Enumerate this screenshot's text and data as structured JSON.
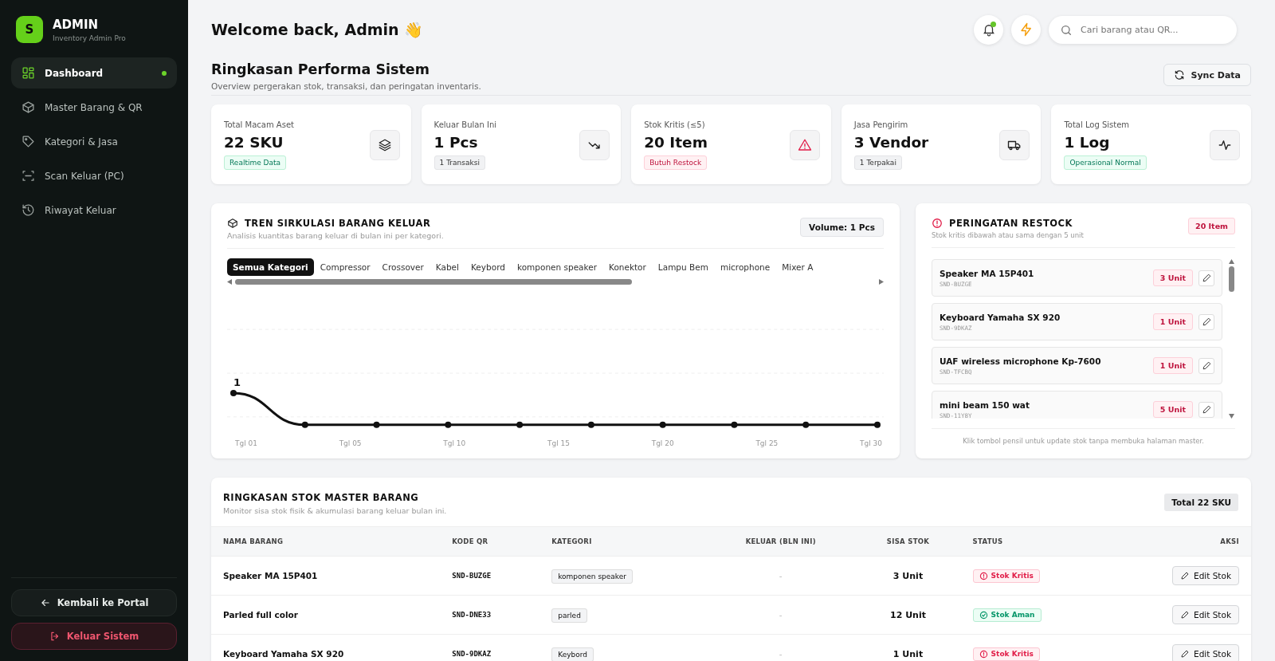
{
  "sidebar": {
    "logo_letter": "S",
    "brand": "ADMIN",
    "subtitle": "Inventory Admin Pro",
    "items": [
      {
        "label": "Dashboard",
        "selected": true
      },
      {
        "label": "Master Barang & QR",
        "selected": false
      },
      {
        "label": "Kategori & Jasa",
        "selected": false
      },
      {
        "label": "Scan Keluar (PC)",
        "selected": false
      },
      {
        "label": "Riwayat Keluar",
        "selected": false
      }
    ],
    "back_button": "Kembali ke Portal",
    "logout_button": "Keluar Sistem"
  },
  "header": {
    "greeting": "Welcome back, Admin 👋",
    "notification_unread": true,
    "search": {
      "placeholder": "Cari barang atau QR..."
    }
  },
  "page": {
    "title": "Ringkasan Performa Sistem",
    "subtitle": "Overview pergerakan stok, transaksi, dan peringatan inventaris.",
    "sync_button": "Sync Data"
  },
  "stats": [
    {
      "label": "Total Macam Aset",
      "value": "22 SKU",
      "badge": "Realtime Data",
      "kind": "success"
    },
    {
      "label": "Keluar Bulan Ini",
      "value": "1 Pcs",
      "badge": "1 Transaksi",
      "kind": "neutral"
    },
    {
      "label": "Stok Kritis (≤5)",
      "value": "20 Item",
      "badge": "Butuh Restock",
      "kind": "danger"
    },
    {
      "label": "Jasa Pengirim",
      "value": "3 Vendor",
      "badge": "1 Terpakai",
      "kind": "neutral"
    },
    {
      "label": "Total Log Sistem",
      "value": "1 Log",
      "badge": "Operasional Normal",
      "kind": "success"
    }
  ],
  "trend": {
    "title": "TREN SIRKULASI BARANG KELUAR",
    "subtitle": "Analisis kuantitas barang keluar di bulan ini per kategori.",
    "volume": "Volume: 1 Pcs",
    "tabs": [
      {
        "label": "Semua Kategori",
        "selected": true
      },
      {
        "label": "Compressor",
        "selected": false
      },
      {
        "label": "Crossover",
        "selected": false
      },
      {
        "label": "Kabel",
        "selected": false
      },
      {
        "label": "Keybord",
        "selected": false
      },
      {
        "label": "komponen speaker",
        "selected": false
      },
      {
        "label": "Konektor",
        "selected": false
      },
      {
        "label": "Lampu Bem",
        "selected": false
      },
      {
        "label": "microphone",
        "selected": false
      },
      {
        "label": "Mixer A",
        "selected": false
      }
    ],
    "point_label": "1",
    "axis_labels": [
      "Tgl 01",
      "Tgl 05",
      "Tgl 10",
      "Tgl 15",
      "Tgl 20",
      "Tgl 25",
      "Tgl 30"
    ]
  },
  "restock": {
    "title": "PERINGATAN RESTOCK",
    "subtitle": "Stok kritis dibawah atau sama dengan 5 unit",
    "count": "20 Item",
    "items": [
      {
        "name": "Speaker MA 15P401",
        "code": "SND-BUZGE",
        "stock": "3 Unit"
      },
      {
        "name": "Keyboard Yamaha SX 920",
        "code": "SND-9DKAZ",
        "stock": "1 Unit"
      },
      {
        "name": "UAF wireless microphone Kp-7600",
        "code": "SND-TFCBQ",
        "stock": "1 Unit"
      },
      {
        "name": "mini beam 150 wat",
        "code": "SND-11Y8Y",
        "stock": "5 Unit"
      }
    ],
    "footer": "Klik tombol pensil untuk update stok tanpa membuka halaman master."
  },
  "table": {
    "title": "RINGKASAN STOK MASTER BARANG",
    "subtitle": "Monitor sisa stok fisik & akumulasi barang keluar bulan ini.",
    "total": "Total 22 SKU",
    "columns": [
      "NAMA BARANG",
      "KODE QR",
      "KATEGORI",
      "KELUAR (BLN INI)",
      "SISA STOK",
      "STATUS",
      "AKSI"
    ],
    "rows": [
      {
        "name": "Speaker MA 15P401",
        "code": "SND-BUZGE",
        "category": "komponen speaker",
        "out": "-",
        "stock": "3 Unit",
        "status": "Stok Kritis",
        "critical": true,
        "action": "Edit Stok"
      },
      {
        "name": "Parled full color",
        "code": "SND-DNE33",
        "category": "parled",
        "out": "-",
        "stock": "12 Unit",
        "status": "Stok Aman",
        "critical": false,
        "action": "Edit Stok"
      },
      {
        "name": "Keyboard Yamaha SX 920",
        "code": "SND-9DKAZ",
        "category": "Keybord",
        "out": "-",
        "stock": "1 Unit",
        "status": "Stok Kritis",
        "critical": true,
        "action": "Edit Stok"
      }
    ]
  }
}
